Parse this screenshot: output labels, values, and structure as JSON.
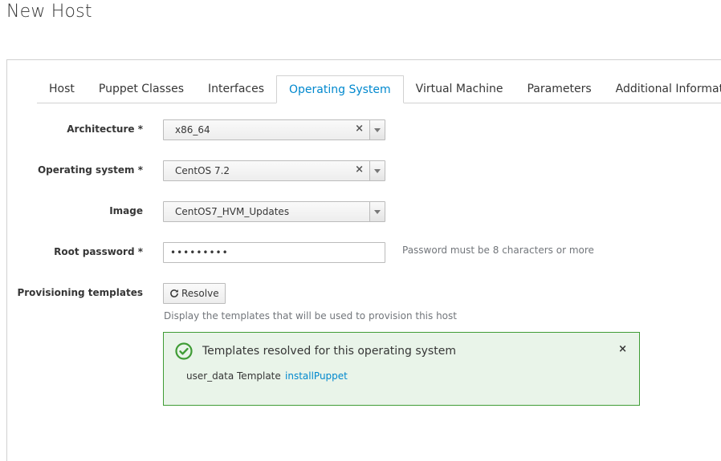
{
  "page": {
    "title": "New Host"
  },
  "tabs": [
    {
      "label": "Host",
      "active": false
    },
    {
      "label": "Puppet Classes",
      "active": false
    },
    {
      "label": "Interfaces",
      "active": false
    },
    {
      "label": "Operating System",
      "active": true
    },
    {
      "label": "Virtual Machine",
      "active": false
    },
    {
      "label": "Parameters",
      "active": false
    },
    {
      "label": "Additional Information",
      "active": false
    }
  ],
  "form": {
    "architecture": {
      "label": "Architecture *",
      "value": "x86_64"
    },
    "operating_system": {
      "label": "Operating system *",
      "value": "CentOS 7.2"
    },
    "image": {
      "label": "Image",
      "value": "CentOS7_HVM_Updates"
    },
    "root_password": {
      "label": "Root password *",
      "value": "•••••••••",
      "help": "Password must be 8 characters or more"
    },
    "provisioning_templates": {
      "label": "Provisioning templates",
      "button_label": "Resolve",
      "help": "Display the templates that will be used to provision this host"
    }
  },
  "alert": {
    "title": "Templates resolved for this operating system",
    "close": "×",
    "template_type": "user_data Template",
    "template_name": "installPuppet"
  },
  "colors": {
    "accent": "#0088ce",
    "success": "#3f9c35",
    "success_bg": "#e9f4e9"
  },
  "icons": {
    "clear": "×",
    "refresh": "refresh-icon",
    "success": "check-circle-icon"
  }
}
